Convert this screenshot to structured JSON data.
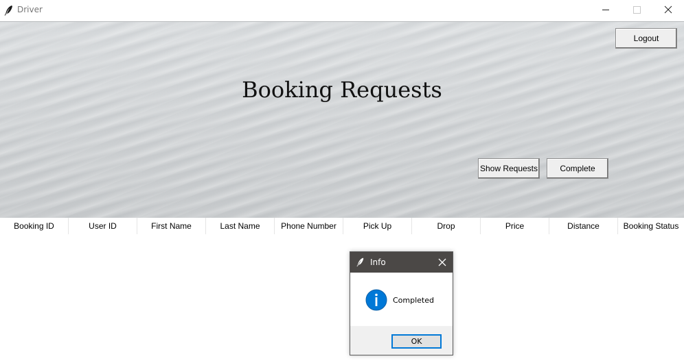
{
  "window": {
    "title": "Driver"
  },
  "hero": {
    "title": "Booking Requests",
    "logout_label": "Logout",
    "show_requests_label": "Show Requests",
    "complete_label": "Complete"
  },
  "table": {
    "columns": [
      "Booking ID",
      "User ID",
      "First Name",
      "Last Name",
      "Phone Number",
      "Pick Up",
      "Drop",
      "Price",
      "Distance",
      "Booking Status"
    ]
  },
  "dialog": {
    "title": "Info",
    "message": "Completed",
    "ok_label": "OK",
    "icon": "info-icon"
  },
  "colors": {
    "dialog_titlebar": "#4b4846",
    "info_icon": "#0078d7",
    "ok_focus": "#0078d7"
  }
}
